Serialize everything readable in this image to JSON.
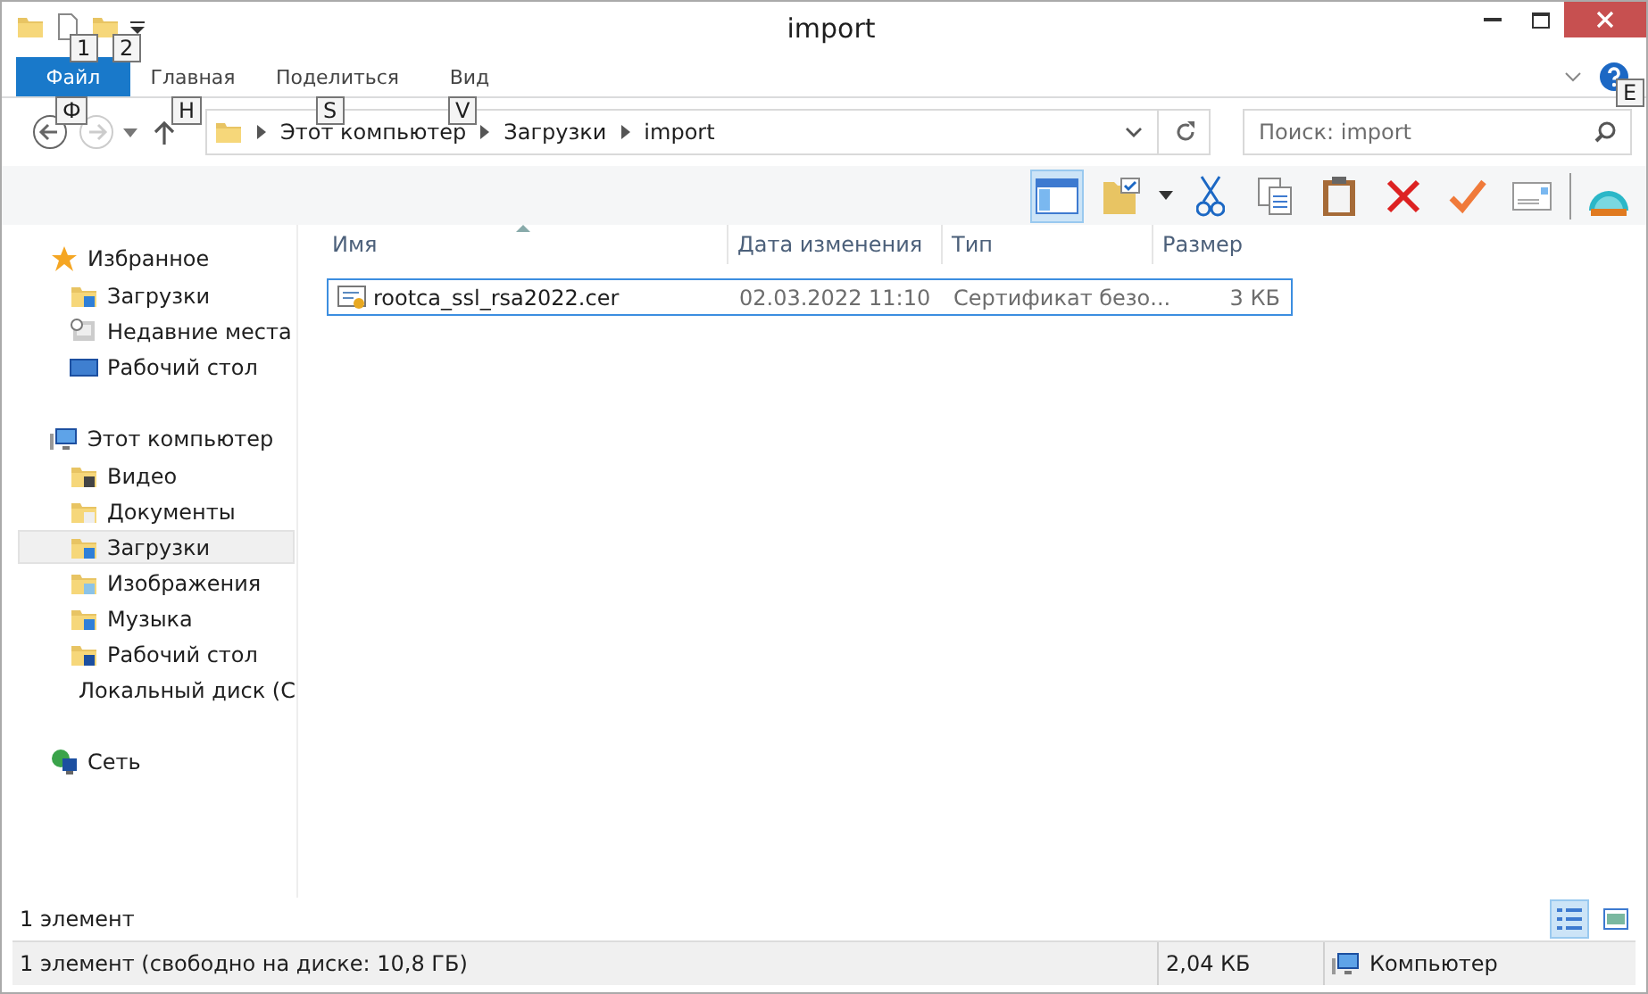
{
  "window": {
    "title": "import"
  },
  "quick_access_keytips": [
    "1",
    "2"
  ],
  "ribbon": {
    "tabs": [
      {
        "label": "Файл",
        "kind": "file",
        "keytip": "Ф",
        "selected": true
      },
      {
        "label": "Главная",
        "kind": "tab",
        "keytip": "H",
        "selected": false
      },
      {
        "label": "Поделиться",
        "kind": "tab",
        "keytip": "S",
        "selected": false
      },
      {
        "label": "Вид",
        "kind": "tab",
        "keytip": "V",
        "selected": false
      }
    ],
    "help_keytip": "E"
  },
  "address": {
    "path": [
      "Этот компьютер",
      "Загрузки",
      "import"
    ]
  },
  "search": {
    "placeholder": "Поиск: import"
  },
  "sidebar": {
    "groups": [
      {
        "label": "Избранное",
        "kind": "favorites",
        "children": [
          {
            "label": "Загрузки",
            "kind": "downloads",
            "selected": false
          },
          {
            "label": "Недавние места",
            "kind": "recent",
            "selected": false
          },
          {
            "label": "Рабочий стол",
            "kind": "desktop",
            "selected": false
          }
        ]
      },
      {
        "label": "Этот компьютер",
        "kind": "computer",
        "children": [
          {
            "label": "Видео",
            "kind": "video",
            "selected": false
          },
          {
            "label": "Документы",
            "kind": "docs",
            "selected": false
          },
          {
            "label": "Загрузки",
            "kind": "downloads",
            "selected": true
          },
          {
            "label": "Изображения",
            "kind": "pictures",
            "selected": false
          },
          {
            "label": "Музыка",
            "kind": "music",
            "selected": false
          },
          {
            "label": "Рабочий стол",
            "kind": "desktopfolder",
            "selected": false
          },
          {
            "label": "Локальный диск (C",
            "kind": "disk",
            "selected": false
          }
        ]
      },
      {
        "label": "Сеть",
        "kind": "network"
      }
    ]
  },
  "table": {
    "columns": [
      "Имя",
      "Дата изменения",
      "Тип",
      "Размер"
    ],
    "rows": [
      {
        "name": "rootca_ssl_rsa2022.cer",
        "date": "02.03.2022 11:10",
        "type": "Сертификат безо...",
        "size": "3 КБ",
        "selected": true
      }
    ]
  },
  "item_count": "1 элемент",
  "status_bar": {
    "info": "1 элемент (свободно на диске: 10,8 ГБ)",
    "size": "2,04 КБ",
    "location": "Компьютер"
  }
}
